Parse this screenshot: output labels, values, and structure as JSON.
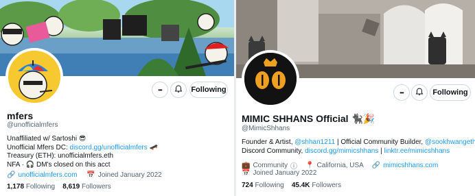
{
  "left": {
    "name": "mfers",
    "handle": "@unofficialmfers",
    "bio_line1": "Unaffiliated w/ Sartoshi 😎",
    "bio_line2_prefix": "Unofficial Mfers DC: ",
    "bio_line2_link": "discord.gg/unofficialmfers",
    "bio_line2_suffix": " 🛹",
    "bio_line3": "Treasury (ETH): unofficialmfers.eth",
    "bio_line4": "NFA · 🎧 DM's closed on this acct",
    "website": "unofficialmfers.com",
    "joined": "Joined January 2022",
    "following_count": "1,178",
    "following_label": "Following",
    "followers_count": "8,619",
    "followers_label": "Followers",
    "follow_button": "Following",
    "more_icon": "•••",
    "notify_icon": "🔔"
  },
  "right": {
    "name": "MIMIC SHHANS Official 🐈‍⬛🎉",
    "handle": "@MimicShhans",
    "bio_line1_prefix": "Founder & Artist, ",
    "bio_line1_link1": "@shhan1211",
    "bio_line1_mid": " | Official Community Builder, ",
    "bio_line1_link2": "@sookhwangeth",
    "bio_line1_suffix": " |",
    "bio_line2_prefix": "Discord Community, ",
    "bio_line2_link1": "discord.gg/mimicshhans",
    "bio_line2_sep": " | ",
    "bio_line2_link2": "linktr.ee/mimicshhans",
    "category": "Community",
    "location": "California, USA",
    "website": "mimicshhans.com",
    "joined": "Joined January 2022",
    "following_count": "724",
    "following_label": "Following",
    "followers_count": "45.4K",
    "followers_label": "Followers",
    "follow_button": "Following",
    "more_icon": "•••",
    "notify_icon": "🔔"
  }
}
